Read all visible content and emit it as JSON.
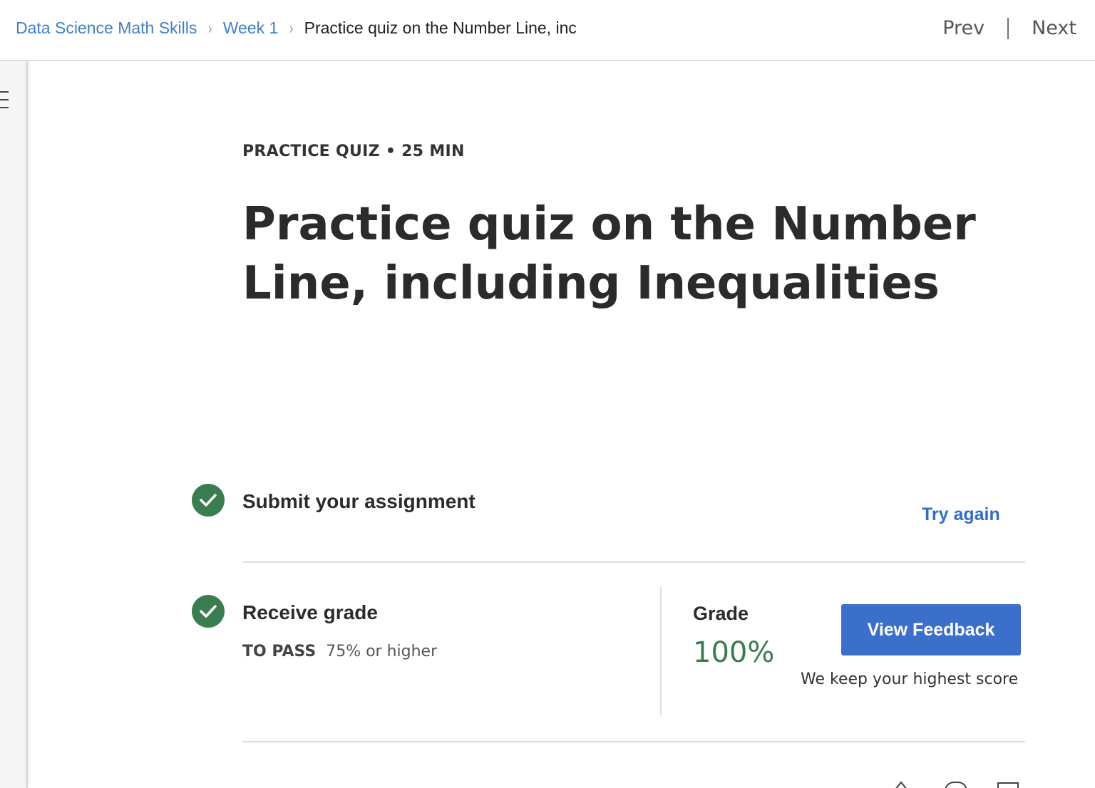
{
  "breadcrumb": {
    "course": "Data Science Math Skills",
    "week": "Week 1",
    "current": "Practice quiz on the Number Line, inc",
    "separator": "›"
  },
  "nav": {
    "prev": "Prev",
    "next": "Next"
  },
  "sidebar": {
    "menu_icon": "menu-icon"
  },
  "quiz": {
    "kicker": "PRACTICE QUIZ • 25 MIN",
    "title": "Practice quiz on the Number Line, including Inequalities"
  },
  "submit_step": {
    "title": "Submit your assignment",
    "action": "Try again",
    "icon": "check-circle-icon"
  },
  "grade_step": {
    "title": "Receive grade",
    "to_pass_label": "TO PASS",
    "to_pass_value": "75% or higher",
    "grade_label": "Grade",
    "grade_value": "100%",
    "button": "View Feedback",
    "note": "We keep your highest score",
    "icon": "check-circle-icon"
  },
  "colors": {
    "link": "#3f7fc7",
    "accent_blue": "#3b6fcb",
    "success_green": "#3a7d4f"
  },
  "footer_icons": [
    "like-icon",
    "dislike-icon",
    "flag-icon"
  ]
}
